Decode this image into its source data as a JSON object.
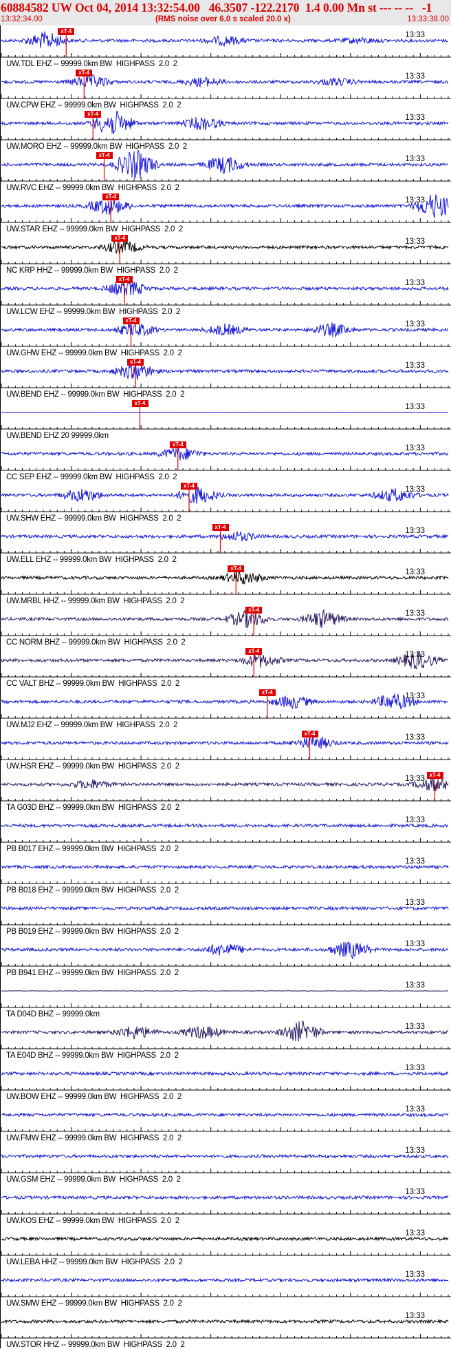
{
  "header": {
    "title": "60884582 UW Oct 04, 2014 13:32:54.00   46.3507 -122.2170  1.4 0.00 Mn st --- -- --   -1",
    "start_time": "13:32:34.00",
    "rms_note": "(RMS noise over 6.0 s scaled 20.0 x)",
    "end_time": "13:33:38.00"
  },
  "time_label": "13:33",
  "pick_label": "xT-4",
  "colors": {
    "background": "#ffffff",
    "header_bg": "#e8e8e8",
    "header_text": "#dd0000",
    "pick": "#e00000",
    "blue": "#1212d8",
    "black": "#000000",
    "navy": "#2a1660"
  },
  "traces": [
    {
      "label": "UW.TDL EHZ -- 99999.0km BW  HIGHPASS  2.0  2",
      "color": "blue",
      "pick": 0.145
    },
    {
      "label": "UW.CPW EHZ -- 99999.0km BW  HIGHPASS  2.0  2",
      "color": "blue",
      "pick": 0.185
    },
    {
      "label": "UW.MORO EHZ -- 99999.0km BW  HIGHPASS  2.0  2",
      "color": "blue",
      "pick": 0.205
    },
    {
      "label": "UW.RVC EHZ -- 99999.0km BW  HIGHPASS  2.0  2",
      "color": "blue",
      "pick": 0.23
    },
    {
      "label": "UW.STAR EHZ -- 99999.0km BW  HIGHPASS  2.0  2",
      "color": "blue",
      "pick": 0.245
    },
    {
      "label": "NC KRP HHZ -- 99999.0km BW  HIGHPASS  2.0  2",
      "color": "black",
      "pick": 0.265
    },
    {
      "label": "UW.LCW EHZ -- 99999.0km BW  HIGHPASS  2.0  2",
      "color": "blue",
      "pick": 0.275
    },
    {
      "label": "UW.GHW EHZ -- 99999.0km BW  HIGHPASS  2.0  2",
      "color": "blue",
      "pick": 0.29
    },
    {
      "label": "UW.BEND EHZ -- 99999.0km BW  HIGHPASS  2.0  2",
      "color": "blue",
      "pick": 0.3
    },
    {
      "label": "UW.BEND EHZ 20 99999.0km",
      "color": "blue",
      "pick": 0.31
    },
    {
      "label": "CC SEP EHZ -- 99999.0km BW  HIGHPASS  2.0  2",
      "color": "blue",
      "pick": 0.395
    },
    {
      "label": "UW.SHW EHZ -- 99999.0km BW  HIGHPASS  2.0  2",
      "color": "blue",
      "pick": 0.42
    },
    {
      "label": "UW.ELL EHZ -- 99999.0km BW  HIGHPASS  2.0  2",
      "color": "blue",
      "pick": 0.49
    },
    {
      "label": "UW.MRBL HHZ -- 99999.0km BW  HIGHPASS  2.0  2",
      "color": "black",
      "pick": 0.525
    },
    {
      "label": "CC NORM BHZ -- 99999.0km BW  HIGHPASS  2.0  2",
      "color": "navy",
      "pick": 0.565
    },
    {
      "label": "CC VALT BHZ -- 99999.0km BW  HIGHPASS  2.0  2",
      "color": "navy",
      "pick": 0.565
    },
    {
      "label": "UW.MJ2 EHZ -- 99999.0km BW  HIGHPASS  2.0  2",
      "color": "blue",
      "pick": 0.595
    },
    {
      "label": "UW.HSR EHZ -- 99999.0km BW  HIGHPASS  2.0  2",
      "color": "blue",
      "pick": 0.69
    },
    {
      "label": "TA G03D BHZ -- 99999.0km BW  HIGHPASS  2.0  2",
      "color": "navy",
      "pick": 0.97
    },
    {
      "label": "PB B017 EHZ -- 99999.0km BW  HIGHPASS  2.0  2",
      "color": "blue",
      "pick": null
    },
    {
      "label": "PB B018 EHZ -- 99999.0km BW  HIGHPASS  2.0  2",
      "color": "blue",
      "pick": null
    },
    {
      "label": "PB B019 EHZ -- 99999.0km BW  HIGHPASS  2.0  2",
      "color": "blue",
      "pick": null
    },
    {
      "label": "PB B941 EHZ -- 99999.0km BW  HIGHPASS  2.0  2",
      "color": "blue",
      "pick": null
    },
    {
      "label": "TA D04D BHZ -- 99999.0km",
      "color": "navy",
      "pick": null
    },
    {
      "label": "TA E04D BHZ -- 99999.0km BW  HIGHPASS  2.0  2",
      "color": "navy",
      "pick": null
    },
    {
      "label": "UW.BOW EHZ -- 99999.0km BW  HIGHPASS  2.0  2",
      "color": "blue",
      "pick": null
    },
    {
      "label": "UW.FMW EHZ -- 99999.0km BW  HIGHPASS  2.0  2",
      "color": "blue",
      "pick": null
    },
    {
      "label": "UW.GSM EHZ -- 99999.0km BW  HIGHPASS  2.0  2",
      "color": "blue",
      "pick": null
    },
    {
      "label": "UW.KOS EHZ -- 99999.0km BW  HIGHPASS  2.0  2",
      "color": "blue",
      "pick": null
    },
    {
      "label": "UW.LEBA HHZ -- 99999.0km BW  HIGHPASS  2.0  2",
      "color": "black",
      "pick": null
    },
    {
      "label": "UW.SMW EHZ -- 99999.0km BW  HIGHPASS  2.0  2",
      "color": "blue",
      "pick": null
    },
    {
      "label": "UW.STOR HHZ -- 99999.0km BW  HIGHPASS  2.0  2",
      "color": "black",
      "pick": null
    }
  ]
}
